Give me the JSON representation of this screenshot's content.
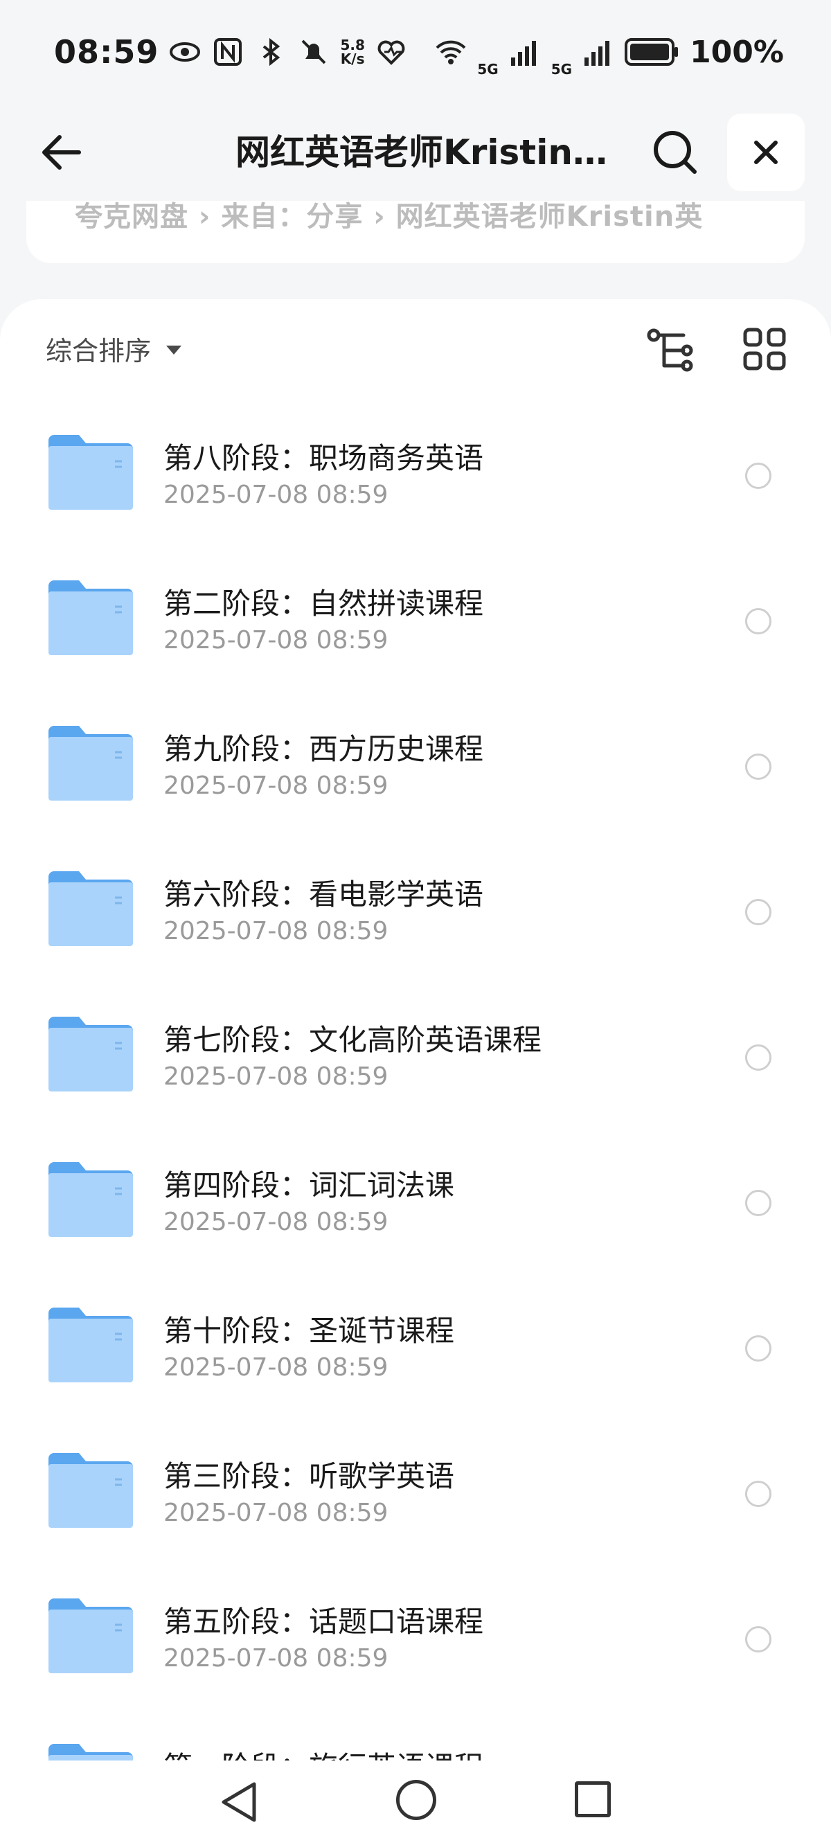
{
  "status_bar": {
    "time": "08:59",
    "speed_value": "5.8",
    "speed_unit": "K/s",
    "battery": "100%",
    "net_1": "5G",
    "net_2": "5G"
  },
  "header": {
    "title": "网红英语老师Kristin..."
  },
  "breadcrumb": {
    "text": "夸克网盘 › 来自：分享 › 网红英语老师Kristin英"
  },
  "toolbar": {
    "sort_label": "综合排序"
  },
  "files": [
    {
      "name": "第八阶段：职场商务英语",
      "date": "2025-07-08 08:59"
    },
    {
      "name": "第二阶段：自然拼读课程",
      "date": "2025-07-08 08:59"
    },
    {
      "name": "第九阶段：西方历史课程",
      "date": "2025-07-08 08:59"
    },
    {
      "name": "第六阶段：看电影学英语",
      "date": "2025-07-08 08:59"
    },
    {
      "name": "第七阶段：文化高阶英语课程",
      "date": "2025-07-08 08:59"
    },
    {
      "name": "第四阶段：词汇词法课",
      "date": "2025-07-08 08:59"
    },
    {
      "name": "第十阶段：圣诞节课程",
      "date": "2025-07-08 08:59"
    },
    {
      "name": "第三阶段：听歌学英语",
      "date": "2025-07-08 08:59"
    },
    {
      "name": "第五阶段：话题口语课程",
      "date": "2025-07-08 08:59"
    },
    {
      "name": "第一阶段：旅行英语课程",
      "date": ""
    }
  ],
  "colors": {
    "folder_top": "#5aa6ef",
    "folder_body": "#a9d3fb",
    "background": "#f5f6f7"
  }
}
